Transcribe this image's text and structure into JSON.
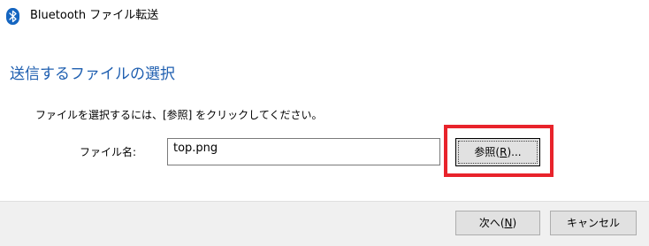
{
  "window": {
    "title": "Bluetooth ファイル転送",
    "icon": "bluetooth-icon",
    "icon_color": "#1565c0"
  },
  "main": {
    "heading": "送信するファイルの選択",
    "heading_color": "#1f5fb0",
    "instruction": "ファイルを選択するには、[参照] をクリックしてください。",
    "filename_label": "ファイル名:",
    "filename_value": "top.png",
    "browse_button": {
      "label_prefix": "参照(",
      "label_key": "R",
      "label_suffix": ")..."
    },
    "highlight_color": "#e8232b"
  },
  "footer": {
    "next_button": {
      "label_prefix": "次へ(",
      "label_key": "N",
      "label_suffix": ")"
    },
    "cancel_button": {
      "label": "キャンセル"
    }
  }
}
